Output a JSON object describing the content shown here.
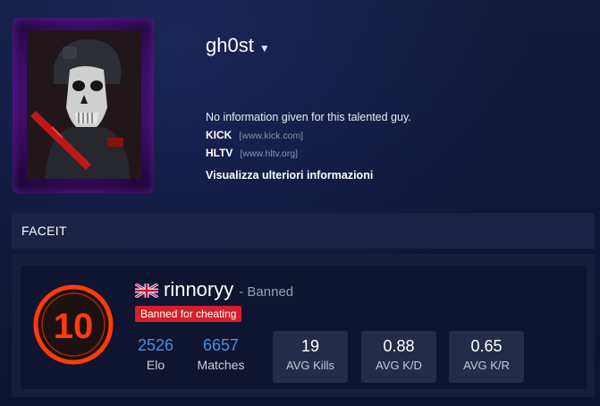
{
  "profile": {
    "username": "gh0st",
    "summary": "No information given for this talented guy.",
    "links": [
      {
        "name": "KICK",
        "url": "[www.kick.com]"
      },
      {
        "name": "HLTV",
        "url": "[www.hltv.org]"
      }
    ],
    "more_info": "Visualizza ulteriori informazioni"
  },
  "faceit": {
    "section_title": "FACEIT",
    "level": "10",
    "country_flag": "uk-flag",
    "nickname": "rinnoryy",
    "status": "- Banned",
    "ban_reason": "Banned for cheating",
    "elo": {
      "value": "2526",
      "label": "Elo"
    },
    "matches": {
      "value": "6657",
      "label": "Matches"
    },
    "stats": [
      {
        "value": "19",
        "label": "AVG Kills"
      },
      {
        "value": "0.88",
        "label": "AVG K/D"
      },
      {
        "value": "0.65",
        "label": "AVG K/R"
      }
    ]
  },
  "colors": {
    "accent_blue": "#4f8fd8",
    "ban_red": "#d3202c",
    "level_red": "#ff3b0a"
  }
}
